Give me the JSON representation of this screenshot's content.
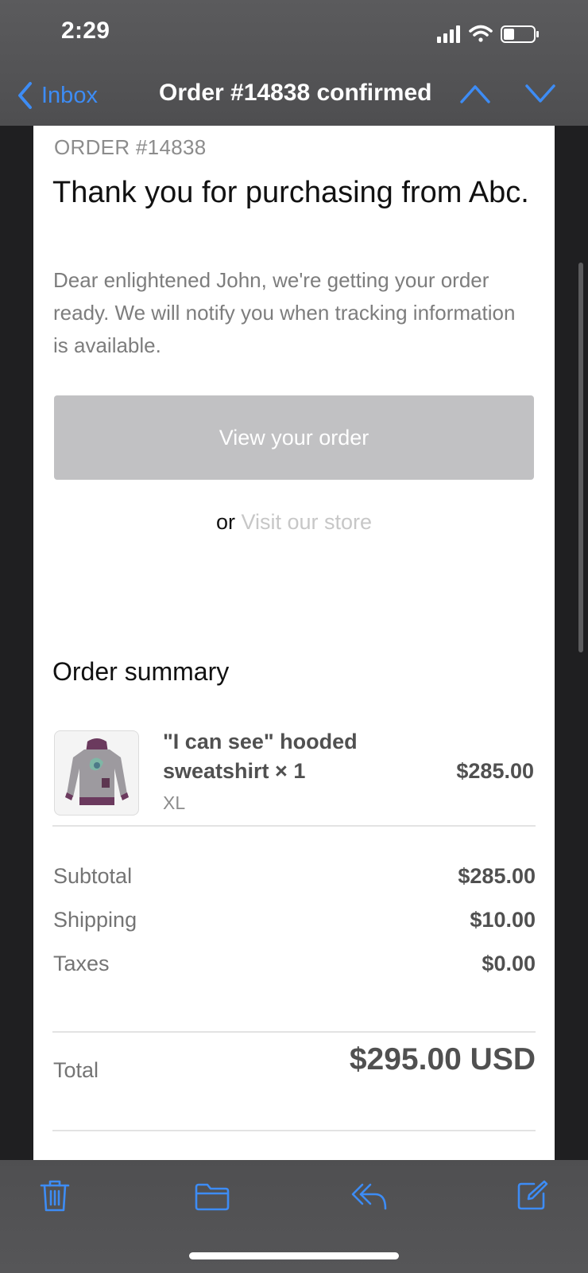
{
  "status_bar": {
    "time": "2:29",
    "signal_icon": "signal-bars-icon",
    "wifi_icon": "wifi-icon",
    "battery_icon": "battery-icon"
  },
  "nav": {
    "back_label": "Inbox",
    "title": "Order #14838 confirmed",
    "up_icon": "chevron-up-icon",
    "down_icon": "chevron-down-icon",
    "accent_color": "#3d8cf5"
  },
  "email": {
    "order_label": "ORDER #14838",
    "headline": "Thank you for purchasing from Abc.",
    "intro": "Dear enlightened John, we're getting your order ready. We will notify you when tracking information is available.",
    "view_order_button": "View your order",
    "or_text": "or",
    "visit_store_link": "Visit our store",
    "summary_title": "Order summary",
    "item": {
      "name": "\"I can see\" hooded sweatshirt × 1",
      "variant": "XL",
      "price": "$285.00",
      "image": "hooded-sweatshirt-thumbnail"
    },
    "totals": {
      "subtotal_label": "Subtotal",
      "subtotal_value": "$285.00",
      "shipping_label": "Shipping",
      "shipping_value": "$10.00",
      "taxes_label": "Taxes",
      "taxes_value": "$0.00",
      "total_label": "Total",
      "total_value": "$295.00 USD"
    }
  },
  "toolbar": {
    "trash_icon": "trash-icon",
    "folder_icon": "folder-icon",
    "reply_icon": "reply-icon",
    "compose_icon": "compose-icon"
  }
}
